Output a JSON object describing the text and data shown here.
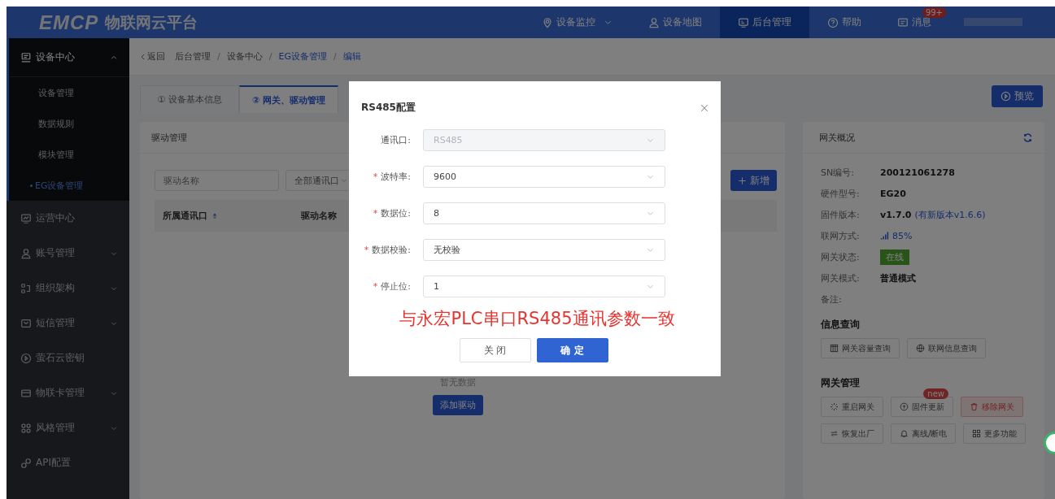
{
  "header": {
    "logo": "EMCP",
    "title": "物联网云平台",
    "nav": [
      {
        "label": "设备监控",
        "dropdown": true,
        "selected": false
      },
      {
        "label": "设备地图",
        "dropdown": false,
        "selected": false
      },
      {
        "label": "后台管理",
        "dropdown": false,
        "selected": true
      },
      {
        "label": "帮助",
        "dropdown": false,
        "selected": false
      },
      {
        "label": "消息",
        "dropdown": false,
        "selected": false,
        "badge": "99+"
      }
    ]
  },
  "sidebar": {
    "items": [
      {
        "label": "设备中心",
        "kind": "group",
        "expanded": true,
        "children": [
          {
            "label": "设备管理",
            "selected": false
          },
          {
            "label": "数据规则",
            "selected": false
          },
          {
            "label": "模块管理",
            "selected": false
          },
          {
            "label": "EG设备管理",
            "selected": true
          }
        ]
      },
      {
        "label": "运营中心",
        "kind": "link",
        "expanded": false
      },
      {
        "label": "账号管理",
        "kind": "group",
        "expanded": false
      },
      {
        "label": "组织架构",
        "kind": "group",
        "expanded": false
      },
      {
        "label": "短信管理",
        "kind": "group",
        "expanded": false
      },
      {
        "label": "萤石云密钥",
        "kind": "link",
        "expanded": false
      },
      {
        "label": "物联卡管理",
        "kind": "group",
        "expanded": false
      },
      {
        "label": "风格管理",
        "kind": "group",
        "expanded": false
      },
      {
        "label": "API配置",
        "kind": "link",
        "expanded": false
      }
    ]
  },
  "breadcrumb": {
    "back": "返回",
    "separator": "/",
    "items": [
      {
        "label": "后台管理",
        "current": false
      },
      {
        "label": "设备中心",
        "current": false
      },
      {
        "label": "EG设备管理",
        "current": true
      },
      {
        "label": "编辑",
        "current": true
      }
    ]
  },
  "tabs": [
    {
      "label": "① 设备基本信息",
      "selected": false
    },
    {
      "label": "② 网关、驱动管理",
      "selected": true
    }
  ],
  "preview_button": "预览",
  "driver_panel": {
    "title": "驱动管理",
    "search_placeholder": "驱动名称",
    "port_select": "全部通讯口",
    "add_button": "新增",
    "columns": [
      {
        "label": "所属通讯口",
        "sortable": true
      },
      {
        "label": "驱动名称",
        "sortable": false
      }
    ],
    "empty_text": "暂无数据",
    "add_driver_button": "添加驱动"
  },
  "gateway_panel": {
    "title": "网关概况",
    "fields": [
      {
        "label": "SN编号:",
        "value": "200121061278",
        "kind": "text"
      },
      {
        "label": "硬件型号:",
        "value": "EG20",
        "kind": "text"
      },
      {
        "label": "固件版本:",
        "value": "v1.7.0",
        "note": "(有新版本v1.6.6)",
        "kind": "text"
      },
      {
        "label": "联网方式:",
        "value": "85%",
        "kind": "signal"
      },
      {
        "label": "网关状态:",
        "value": "在线",
        "kind": "tag"
      },
      {
        "label": "网关模式:",
        "value": "普通模式",
        "kind": "text"
      },
      {
        "label": "备注:"
      }
    ],
    "info_title": "信息查询",
    "info_buttons": [
      {
        "label": "网关容量查询",
        "kind": "default"
      },
      {
        "label": "联网信息查询",
        "kind": "default"
      }
    ],
    "manage_title": "网关管理",
    "manage_buttons": [
      {
        "label": "重启网关",
        "kind": "default"
      },
      {
        "label": "固件更新",
        "kind": "default",
        "badge": "new"
      },
      {
        "label": "移除网关",
        "kind": "danger"
      },
      {
        "label": "恢复出厂",
        "kind": "default"
      },
      {
        "label": "离线/断电",
        "kind": "default"
      },
      {
        "label": "更多功能",
        "kind": "default"
      }
    ]
  },
  "dialog": {
    "title": "RS485配置",
    "required_mark": "*",
    "fields": [
      {
        "label": "通讯口:",
        "value": "RS485",
        "required": false,
        "disabled": true
      },
      {
        "label": "波特率:",
        "value": "9600",
        "required": true,
        "disabled": false
      },
      {
        "label": "数据位:",
        "value": "8",
        "required": true,
        "disabled": false
      },
      {
        "label": "数据校验:",
        "value": "无校验",
        "required": true,
        "disabled": false
      },
      {
        "label": "停止位:",
        "value": "1",
        "required": true,
        "disabled": false
      }
    ],
    "annotation": "与永宏PLC串口RS485通讯参数一致",
    "buttons": [
      {
        "label": "关 闭",
        "kind": "default"
      },
      {
        "label": "确 定",
        "kind": "primary"
      }
    ]
  }
}
